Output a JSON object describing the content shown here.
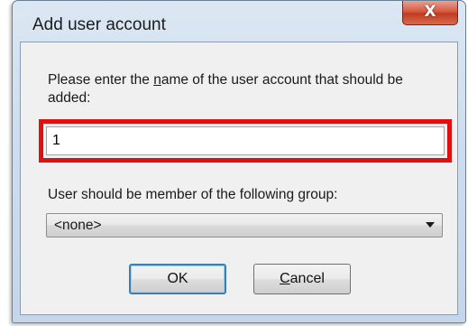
{
  "window": {
    "title": "Add user account",
    "close_symbol": "X"
  },
  "form": {
    "name_label_pre": "Please enter the ",
    "name_label_accel": "n",
    "name_label_post": "ame of the user account that should be added:",
    "name_value": "1",
    "group_label_pre": "User should be member of the following ",
    "group_label_accel": "g",
    "group_label_post": "roup:",
    "group_selected": "<none>"
  },
  "buttons": {
    "ok": "OK",
    "cancel_accel": "C",
    "cancel_rest": "ancel"
  },
  "colors": {
    "highlight": "#e01010",
    "close_button": "#c9452b"
  },
  "icons": {
    "close": "close-icon",
    "dropdown": "chevron-down-icon"
  }
}
